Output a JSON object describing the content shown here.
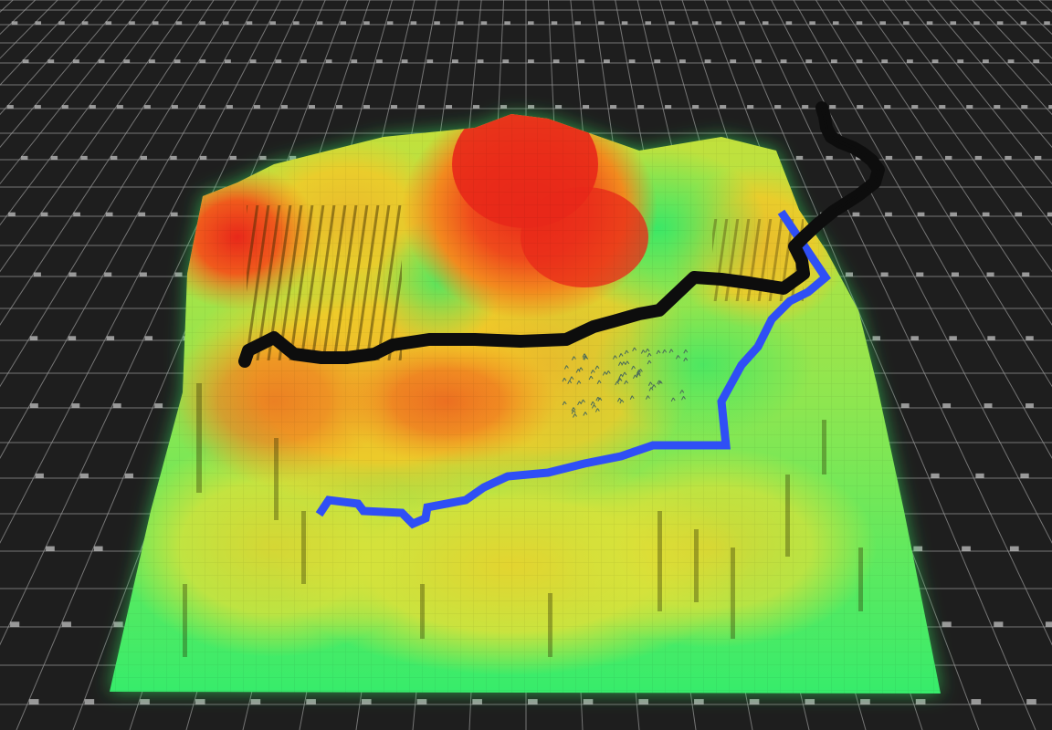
{
  "scene": {
    "view": "isometric-3d-voxel-terrain",
    "colors": {
      "background": "#1e1e1e",
      "grid_line": "#9a9a9a",
      "grid_marker": "#b8b8b8",
      "elevation_low": "#2ee86a",
      "elevation_mid_low": "#b8ea3a",
      "elevation_mid": "#f2c928",
      "elevation_mid_high": "#f28a1e",
      "elevation_high": "#e8281a",
      "route_dark": "#0d0d0d",
      "route_blue": "#2f4ff5",
      "glow": "#3cff6a",
      "tree_marks": "#4a6a5a"
    },
    "layers": [
      {
        "name": "ground-grid",
        "visible": true
      },
      {
        "name": "terrain-voxels",
        "visible": true
      },
      {
        "name": "route-dark-path",
        "visible": true
      },
      {
        "name": "route-blue-path",
        "visible": true
      },
      {
        "name": "vegetation-markers",
        "visible": true
      }
    ]
  }
}
